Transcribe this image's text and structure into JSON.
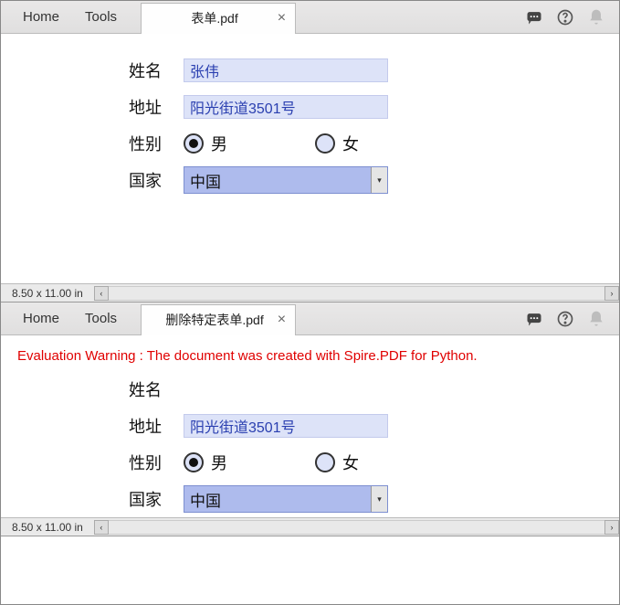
{
  "pane1": {
    "tabs": {
      "home": "Home",
      "tools": "Tools"
    },
    "doc_tab": {
      "title": "表单.pdf",
      "close": "×"
    },
    "form": {
      "name_label": "姓名",
      "name_value": "张伟",
      "address_label": "地址",
      "address_value": "阳光街道3501号",
      "gender_label": "性别",
      "gender_male": "男",
      "gender_female": "女",
      "country_label": "国家",
      "country_value": "中国"
    },
    "status": {
      "page_dim": "8.50 x 11.00 in"
    }
  },
  "pane2": {
    "tabs": {
      "home": "Home",
      "tools": "Tools"
    },
    "doc_tab": {
      "title": "删除特定表单.pdf",
      "close": "×"
    },
    "warning": "Evaluation Warning : The document was created with Spire.PDF for Python.",
    "form": {
      "name_label": "姓名",
      "address_label": "地址",
      "address_value": "阳光街道3501号",
      "gender_label": "性别",
      "gender_male": "男",
      "gender_female": "女",
      "country_label": "国家",
      "country_value": "中国"
    },
    "status": {
      "page_dim": "8.50 x 11.00 in"
    }
  },
  "scroll": {
    "left": "‹",
    "right": "›"
  }
}
